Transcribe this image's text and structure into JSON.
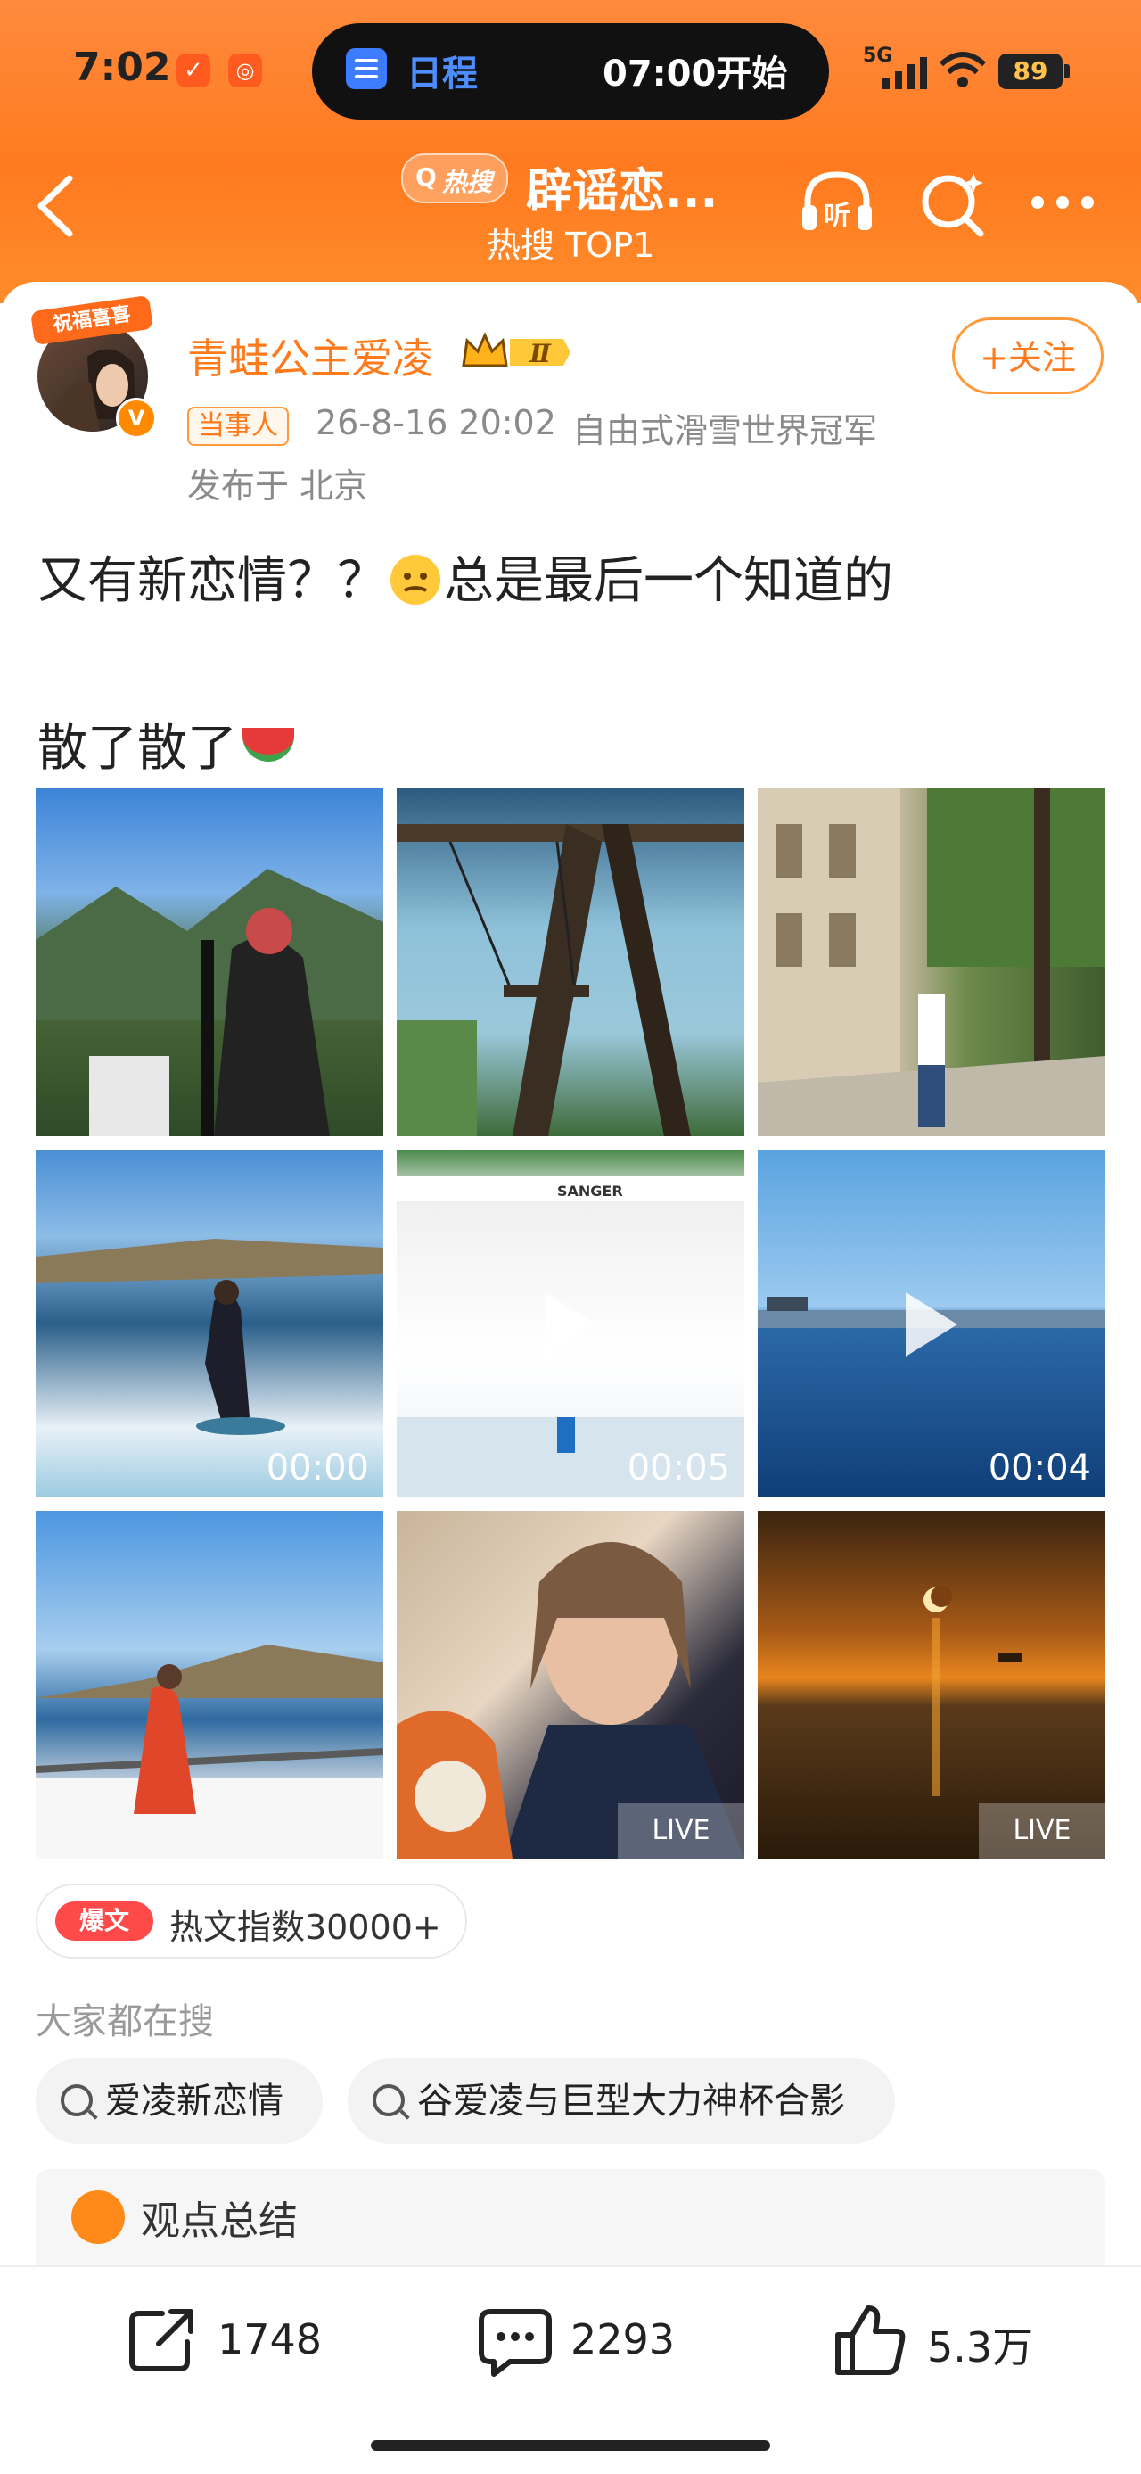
{
  "status_bar": {
    "time": "7:02",
    "calendar_label": "日程",
    "calendar_time": "07:00开始",
    "network": "5G",
    "battery": "89"
  },
  "header": {
    "hot_badge": "热搜",
    "topic_title": "辟谣恋...",
    "topic_subtitle": "热搜 TOP1",
    "icons": [
      "back-icon",
      "listen-icon",
      "search-icon",
      "more-icon"
    ],
    "listen_label": "听"
  },
  "post": {
    "avatar_tag": "祝福喜喜",
    "username": "青蛙公主爱凌",
    "level": "Ⅱ",
    "follow_label": "+关注",
    "party_tag": "当事人",
    "time": "26-8-16 20:02",
    "author_title": "自由式滑雪世界冠军",
    "location": "发布于 北京",
    "text_line1_a": "又有新恋情？？",
    "text_line1_b": "总是最后一个知道的",
    "text_line2": "散了散了",
    "media": [
      {
        "kind": "photo"
      },
      {
        "kind": "photo"
      },
      {
        "kind": "photo"
      },
      {
        "kind": "video",
        "duration": "00:00"
      },
      {
        "kind": "video",
        "duration": "00:05"
      },
      {
        "kind": "video",
        "duration": "00:04"
      },
      {
        "kind": "photo"
      },
      {
        "kind": "live",
        "label": "LIVE"
      },
      {
        "kind": "live",
        "label": "LIVE"
      }
    ]
  },
  "hot_article": {
    "badge": "爆文",
    "text": "热文指数30000+"
  },
  "searches": {
    "heading": "大家都在搜",
    "items": [
      "爱凌新恋情",
      "谷爱凌与巨型大力神杯合影"
    ]
  },
  "summary": {
    "label": "观点总结"
  },
  "actions": {
    "repost": "1748",
    "comment": "2293",
    "like": "5.3万"
  },
  "colors": {
    "accent": "#ff7a1a",
    "header_gradient_top": "#ff8a3d"
  }
}
